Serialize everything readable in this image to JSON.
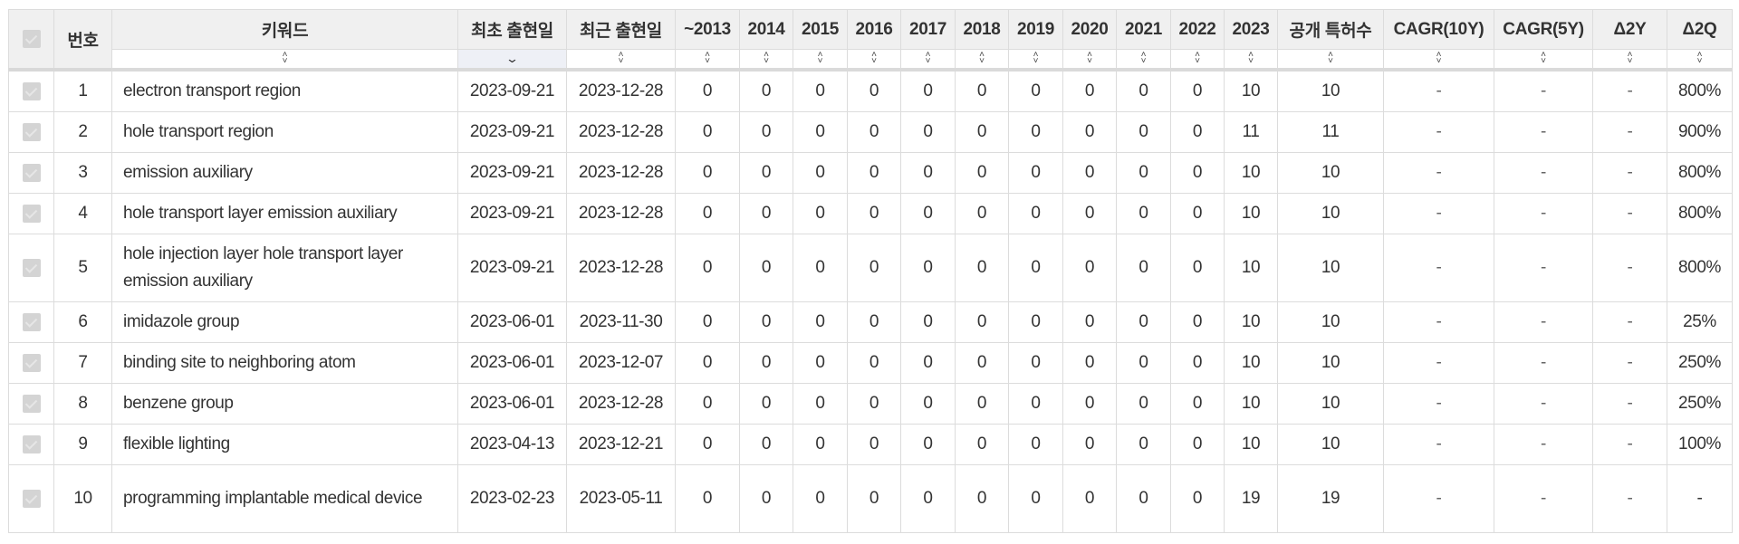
{
  "table": {
    "columns": [
      {
        "key": "checkbox",
        "label": ""
      },
      {
        "key": "no",
        "label": "번호"
      },
      {
        "key": "keyword",
        "label": "키워드",
        "sort": "none"
      },
      {
        "key": "first_seen",
        "label": "최초 출현일",
        "sort": "desc"
      },
      {
        "key": "last_seen",
        "label": "최근 출현일",
        "sort": "none"
      },
      {
        "key": "y2013",
        "label": "~2013",
        "sort": "none"
      },
      {
        "key": "y2014",
        "label": "2014",
        "sort": "none"
      },
      {
        "key": "y2015",
        "label": "2015",
        "sort": "none"
      },
      {
        "key": "y2016",
        "label": "2016",
        "sort": "none"
      },
      {
        "key": "y2017",
        "label": "2017",
        "sort": "none"
      },
      {
        "key": "y2018",
        "label": "2018",
        "sort": "none"
      },
      {
        "key": "y2019",
        "label": "2019",
        "sort": "none"
      },
      {
        "key": "y2020",
        "label": "2020",
        "sort": "none"
      },
      {
        "key": "y2021",
        "label": "2021",
        "sort": "none"
      },
      {
        "key": "y2022",
        "label": "2022",
        "sort": "none"
      },
      {
        "key": "y2023",
        "label": "2023",
        "sort": "none"
      },
      {
        "key": "patents",
        "label": "공개 특허수",
        "sort": "none"
      },
      {
        "key": "cagr10",
        "label": "CAGR(10Y)",
        "sort": "none"
      },
      {
        "key": "cagr5",
        "label": "CAGR(5Y)",
        "sort": "none"
      },
      {
        "key": "d2y",
        "label": "Δ2Y",
        "sort": "none"
      },
      {
        "key": "d2q",
        "label": "Δ2Q",
        "sort": "none"
      }
    ],
    "sort_icons": {
      "none": "sort-both-icon",
      "desc": "chevron-down-icon"
    },
    "rows": [
      {
        "no": "1",
        "keyword": "electron transport region",
        "first_seen": "2023-09-21",
        "last_seen": "2023-12-28",
        "years": [
          "0",
          "0",
          "0",
          "0",
          "0",
          "0",
          "0",
          "0",
          "0",
          "0",
          "10"
        ],
        "patents": "10",
        "cagr10": "-",
        "cagr5": "-",
        "d2y": "-",
        "d2q": "800%",
        "tall": false
      },
      {
        "no": "2",
        "keyword": "hole transport region",
        "first_seen": "2023-09-21",
        "last_seen": "2023-12-28",
        "years": [
          "0",
          "0",
          "0",
          "0",
          "0",
          "0",
          "0",
          "0",
          "0",
          "0",
          "11"
        ],
        "patents": "11",
        "cagr10": "-",
        "cagr5": "-",
        "d2y": "-",
        "d2q": "900%",
        "tall": false
      },
      {
        "no": "3",
        "keyword": "emission auxiliary",
        "first_seen": "2023-09-21",
        "last_seen": "2023-12-28",
        "years": [
          "0",
          "0",
          "0",
          "0",
          "0",
          "0",
          "0",
          "0",
          "0",
          "0",
          "10"
        ],
        "patents": "10",
        "cagr10": "-",
        "cagr5": "-",
        "d2y": "-",
        "d2q": "800%",
        "tall": false
      },
      {
        "no": "4",
        "keyword": "hole transport layer emission auxiliary",
        "first_seen": "2023-09-21",
        "last_seen": "2023-12-28",
        "years": [
          "0",
          "0",
          "0",
          "0",
          "0",
          "0",
          "0",
          "0",
          "0",
          "0",
          "10"
        ],
        "patents": "10",
        "cagr10": "-",
        "cagr5": "-",
        "d2y": "-",
        "d2q": "800%",
        "tall": false
      },
      {
        "no": "5",
        "keyword": "hole injection layer hole transport layer emission auxiliary",
        "first_seen": "2023-09-21",
        "last_seen": "2023-12-28",
        "years": [
          "0",
          "0",
          "0",
          "0",
          "0",
          "0",
          "0",
          "0",
          "0",
          "0",
          "10"
        ],
        "patents": "10",
        "cagr10": "-",
        "cagr5": "-",
        "d2y": "-",
        "d2q": "800%",
        "tall": true
      },
      {
        "no": "6",
        "keyword": "imidazole group",
        "first_seen": "2023-06-01",
        "last_seen": "2023-11-30",
        "years": [
          "0",
          "0",
          "0",
          "0",
          "0",
          "0",
          "0",
          "0",
          "0",
          "0",
          "10"
        ],
        "patents": "10",
        "cagr10": "-",
        "cagr5": "-",
        "d2y": "-",
        "d2q": "25%",
        "tall": false
      },
      {
        "no": "7",
        "keyword": "binding site to neighboring atom",
        "first_seen": "2023-06-01",
        "last_seen": "2023-12-07",
        "years": [
          "0",
          "0",
          "0",
          "0",
          "0",
          "0",
          "0",
          "0",
          "0",
          "0",
          "10"
        ],
        "patents": "10",
        "cagr10": "-",
        "cagr5": "-",
        "d2y": "-",
        "d2q": "250%",
        "tall": false
      },
      {
        "no": "8",
        "keyword": "benzene group",
        "first_seen": "2023-06-01",
        "last_seen": "2023-12-28",
        "years": [
          "0",
          "0",
          "0",
          "0",
          "0",
          "0",
          "0",
          "0",
          "0",
          "0",
          "10"
        ],
        "patents": "10",
        "cagr10": "-",
        "cagr5": "-",
        "d2y": "-",
        "d2q": "250%",
        "tall": false
      },
      {
        "no": "9",
        "keyword": "flexible lighting",
        "first_seen": "2023-04-13",
        "last_seen": "2023-12-21",
        "years": [
          "0",
          "0",
          "0",
          "0",
          "0",
          "0",
          "0",
          "0",
          "0",
          "0",
          "10"
        ],
        "patents": "10",
        "cagr10": "-",
        "cagr5": "-",
        "d2y": "-",
        "d2q": "100%",
        "tall": false
      },
      {
        "no": "10",
        "keyword": "programming implantable medical device",
        "first_seen": "2023-02-23",
        "last_seen": "2023-05-11",
        "years": [
          "0",
          "0",
          "0",
          "0",
          "0",
          "0",
          "0",
          "0",
          "0",
          "0",
          "19"
        ],
        "patents": "19",
        "cagr10": "-",
        "cagr5": "-",
        "d2y": "-",
        "d2q": "-",
        "tall": true
      }
    ]
  }
}
